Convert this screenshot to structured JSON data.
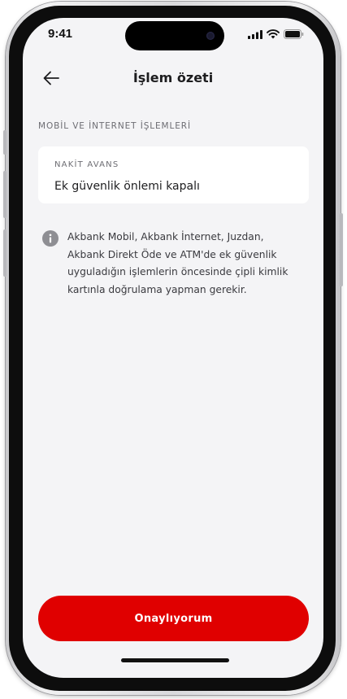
{
  "status_bar": {
    "time": "9:41"
  },
  "header": {
    "title": "İşlem özeti"
  },
  "section": {
    "label": "MOBİL VE İNTERNET İŞLEMLERİ"
  },
  "card": {
    "label": "NAKİT AVANS",
    "value": "Ek güvenlik önlemi kapalı"
  },
  "info": {
    "text": "Akbank Mobil, Akbank İnternet, Juzdan, Akbank Direkt Öde ve ATM'de ek güvenlik uyguladığın işlemlerin öncesinde çipli kimlik kartınla doğrulama yapman gerekir."
  },
  "footer": {
    "confirm_label": "Onaylıyorum"
  },
  "colors": {
    "accent": "#e00000",
    "background": "#f4f4f6"
  },
  "icons": [
    "back-arrow-icon",
    "info-icon",
    "signal-icon",
    "wifi-icon",
    "battery-icon"
  ]
}
